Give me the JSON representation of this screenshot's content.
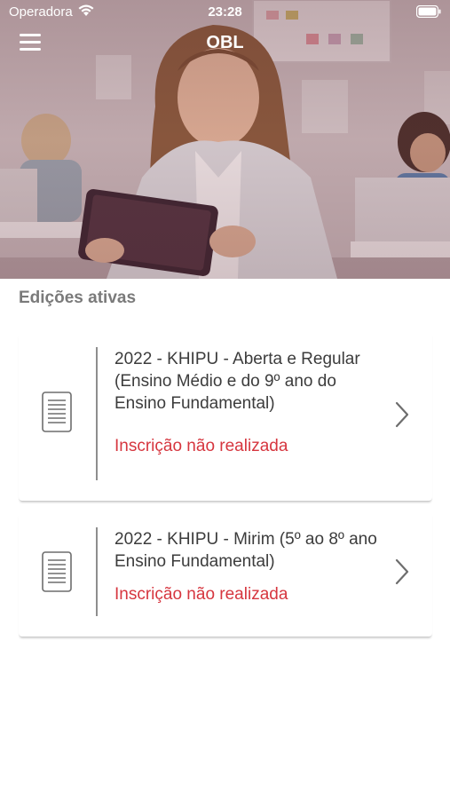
{
  "status_bar": {
    "carrier": "Operadora",
    "time": "23:28",
    "wifi_icon": "wifi-icon",
    "battery_icon": "battery-icon"
  },
  "nav": {
    "title": "OBL",
    "menu_icon": "hamburger-menu-icon"
  },
  "hero": {
    "description_icon": "student-with-tablet-photo"
  },
  "section": {
    "title": "Edições ativas"
  },
  "cards": [
    {
      "title": "2022 - KHIPU - Aberta e Regular (Ensino Médio e do 9º ano do Ensino Fundamental)",
      "status": "Inscrição não realizada",
      "icon": "document-icon"
    },
    {
      "title": "2022 - KHIPU - Mirim (5º ao 8º ano Ensino Fundamental)",
      "status": "Inscrição não realizada",
      "icon": "document-icon"
    }
  ],
  "colors": {
    "status_red": "#d6363f",
    "section_gray": "#7a7a7a",
    "title_text": "#3c3c3c"
  }
}
